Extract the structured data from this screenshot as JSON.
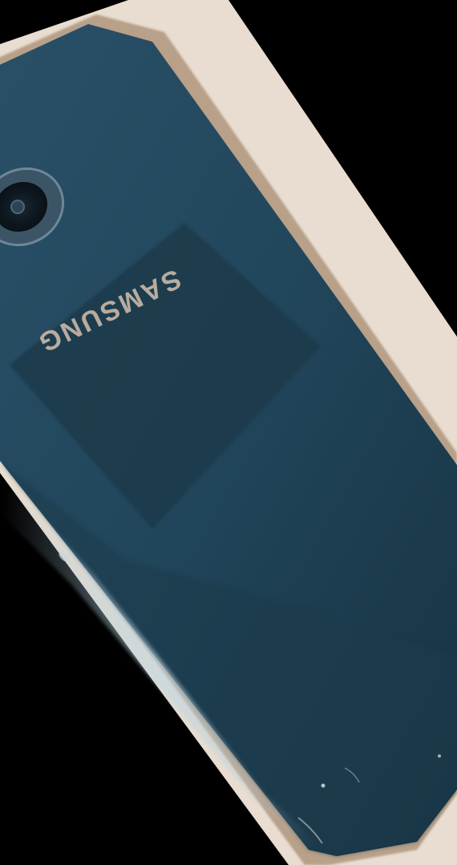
{
  "photo": {
    "subject": "smartphone-back",
    "brand_text": "SAMSUNG",
    "brand_text_mirrored": true,
    "colors": {
      "background": "#000000",
      "tabletop": "#e8ddd0",
      "phone_body": "#24465a",
      "phone_body_dark": "#16303f",
      "frame_edge": "#b8a089",
      "sticker": "#1e3a4c",
      "brand_text": "#c9b8a8",
      "highlight": "#9fc3d6"
    }
  }
}
